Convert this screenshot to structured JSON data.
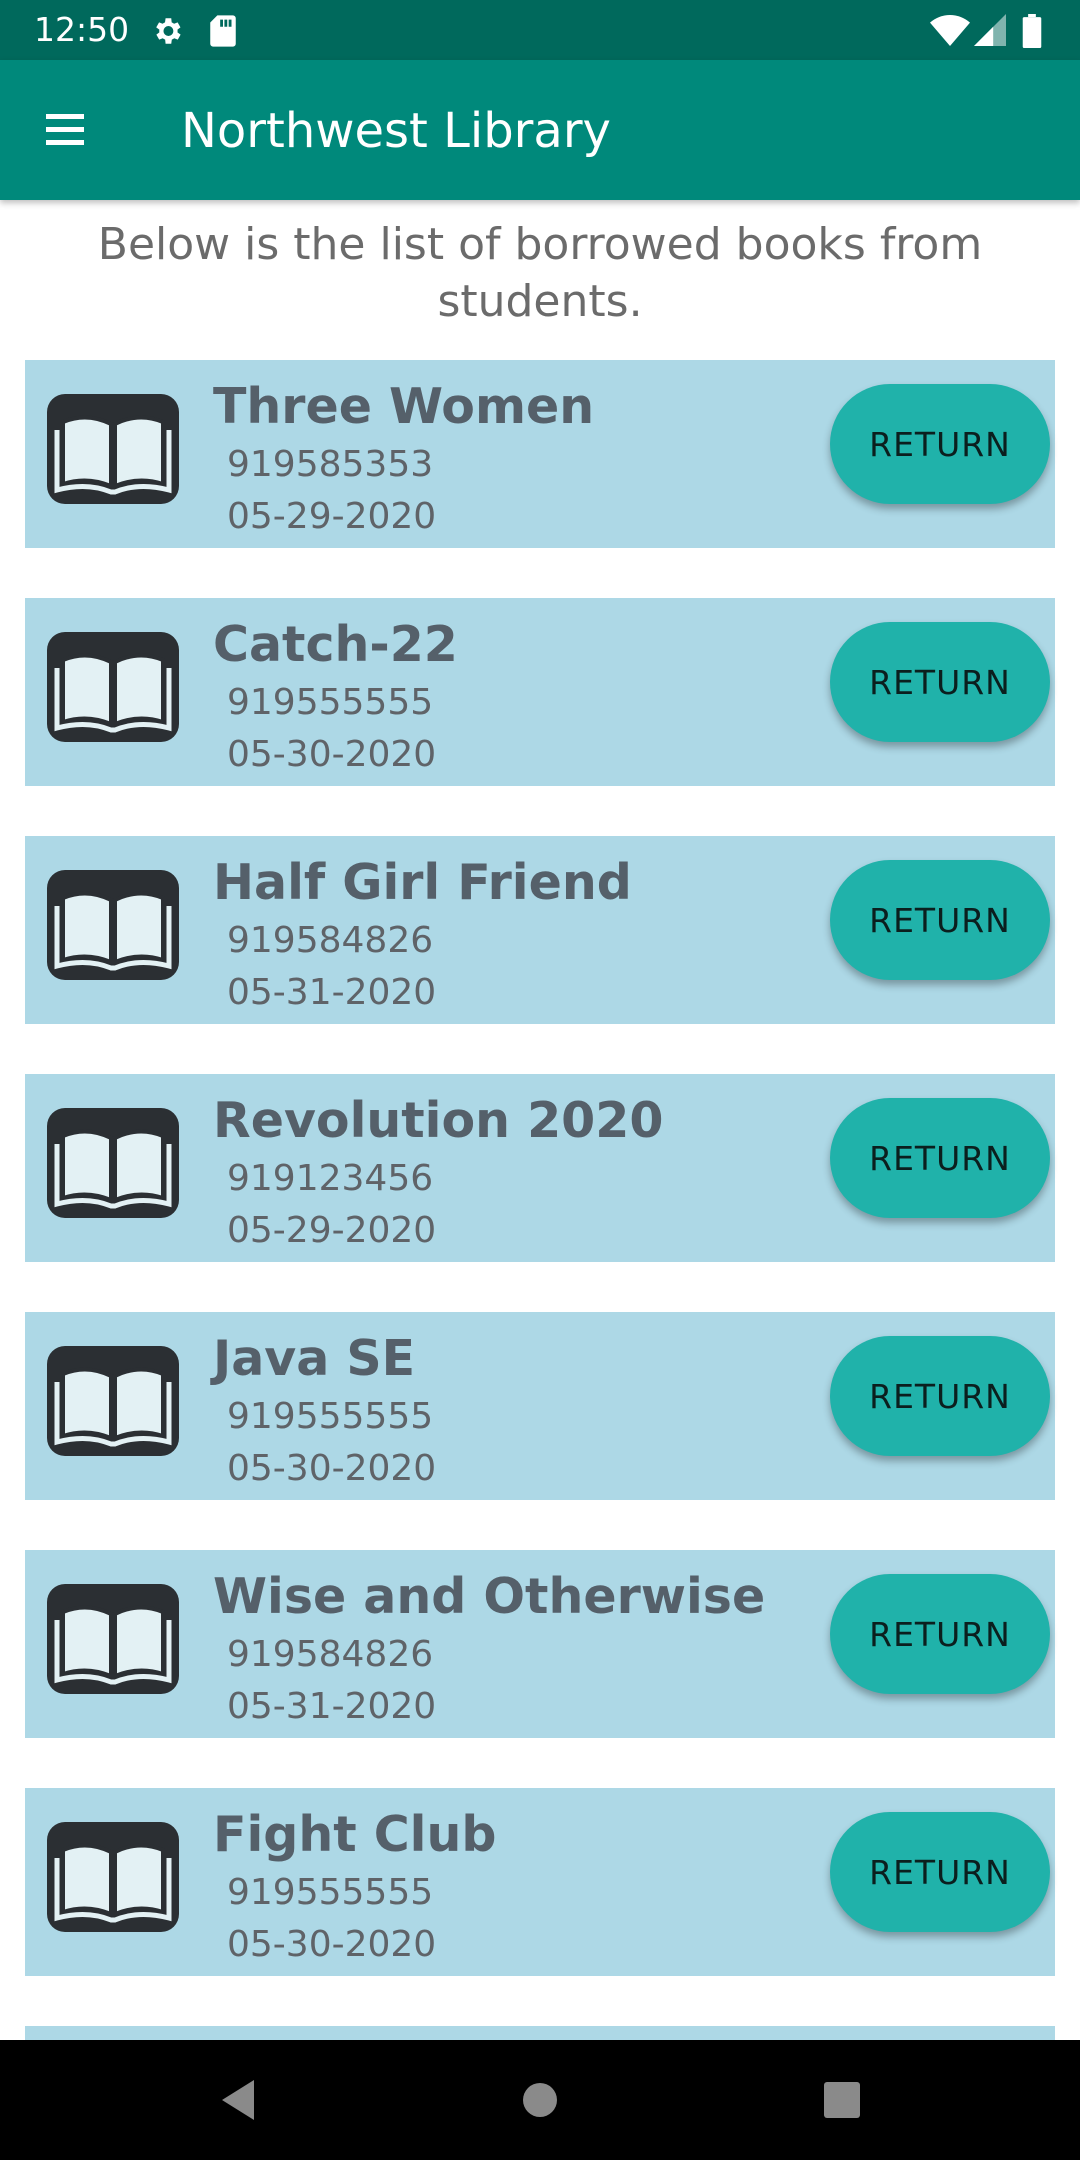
{
  "status_bar": {
    "time": "12:50",
    "icons": [
      "settings-icon",
      "sd-card-icon",
      "wifi-icon",
      "signal-icon",
      "battery-icon"
    ]
  },
  "app_bar": {
    "title": "Northwest Library",
    "menu_icon": "hamburger-menu-icon",
    "color": "#00897b"
  },
  "intro_text": "Below is the list of borrowed books from students.",
  "books": [
    {
      "title": "Three Women",
      "phone": "919585353",
      "date": "05-29-2020",
      "button": "RETURN"
    },
    {
      "title": "Catch-22",
      "phone": "919555555",
      "date": "05-30-2020",
      "button": "RETURN"
    },
    {
      "title": "Half Girl Friend",
      "phone": "919584826",
      "date": "05-31-2020",
      "button": "RETURN"
    },
    {
      "title": "Revolution 2020",
      "phone": "919123456",
      "date": "05-29-2020",
      "button": "RETURN"
    },
    {
      "title": "Java SE",
      "phone": "919555555",
      "date": "05-30-2020",
      "button": "RETURN"
    },
    {
      "title": "Wise and Otherwise",
      "phone": "919584826",
      "date": "05-31-2020",
      "button": "RETURN"
    },
    {
      "title": "Fight Club",
      "phone": "919555555",
      "date": "05-30-2020",
      "button": "RETURN"
    }
  ],
  "colors": {
    "status_bar": "#00695c",
    "card_background": "#add8e6",
    "button_background": "#20b2aa"
  },
  "nav_bar": {
    "icons": [
      "back-icon",
      "home-icon",
      "recents-icon"
    ]
  }
}
